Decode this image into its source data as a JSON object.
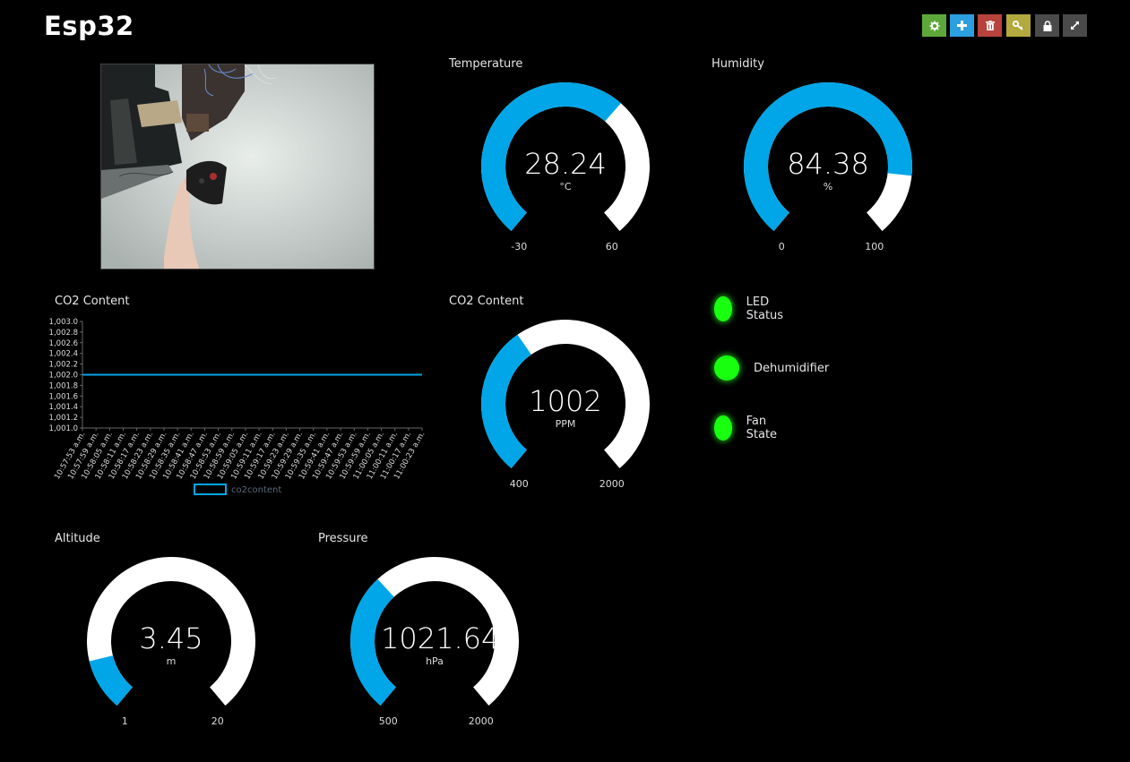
{
  "app": {
    "title": "Esp32"
  },
  "toolbar": {
    "buttons": [
      {
        "icon": "gear-icon",
        "color": "#5ea83b"
      },
      {
        "icon": "plus-icon",
        "color": "#2c9fe0"
      },
      {
        "icon": "trash-icon",
        "color": "#b8423c"
      },
      {
        "icon": "key-icon",
        "color": "#b3a93f"
      },
      {
        "icon": "lock-icon",
        "color": "#4a4a4a"
      },
      {
        "icon": "expand-icon",
        "color": "#4a4a4a"
      }
    ]
  },
  "colors": {
    "accent": "#00a6e7",
    "track": "#ffffff",
    "led_on": "#19ff10"
  },
  "gauges": {
    "temperature": {
      "title": "Temperature",
      "value": "28.24",
      "unit": "°C",
      "min": "-30",
      "max": "60",
      "fraction": 0.647
    },
    "humidity": {
      "title": "Humidity",
      "value": "84.38",
      "unit": "%",
      "min": "0",
      "max": "100",
      "fraction": 0.844
    },
    "co2": {
      "title": "CO2 Content",
      "value": "1002",
      "unit": "PPM",
      "min": "400",
      "max": "2000",
      "fraction": 0.376
    },
    "altitude": {
      "title": "Altitude",
      "value": "3.45",
      "unit": "m",
      "min": "1",
      "max": "20",
      "fraction": 0.129
    },
    "pressure": {
      "title": "Pressure",
      "value": "1021.64",
      "unit": "hPa",
      "min": "500",
      "max": "2000",
      "fraction": 0.348
    }
  },
  "co2_chart_title": "CO2 Content",
  "chart_data": {
    "type": "line",
    "title": "",
    "x": [
      "10:57:53 a.m.",
      "10:57:59 a.m.",
      "10:58:05 a.m.",
      "10:58:11 a.m.",
      "10:58:17 a.m.",
      "10:58:23 a.m.",
      "10:58:29 a.m.",
      "10:58:35 a.m.",
      "10:58:41 a.m.",
      "10:58:47 a.m.",
      "10:58:53 a.m.",
      "10:58:59 a.m.",
      "10:59:05 a.m.",
      "10:59:11 a.m.",
      "10:59:17 a.m.",
      "10:59:23 a.m.",
      "10:59:29 a.m.",
      "10:59:35 a.m.",
      "10:59:41 a.m.",
      "10:59:47 a.m.",
      "10:59:53 a.m.",
      "10:59:59 a.m.",
      "11:00:05 a.m.",
      "11:00:11 a.m.",
      "11:00:17 a.m.",
      "11:00:23 a.m."
    ],
    "series": [
      {
        "name": "co2content",
        "values": [
          1002,
          1002,
          1002,
          1002,
          1002,
          1002,
          1002,
          1002,
          1002,
          1002,
          1002,
          1002,
          1002,
          1002,
          1002,
          1002,
          1002,
          1002,
          1002,
          1002,
          1002,
          1002,
          1002,
          1002,
          1002,
          1002
        ]
      }
    ],
    "yticks": [
      "1,001.0",
      "1,001.2",
      "1,001.4",
      "1,001.6",
      "1,001.8",
      "1,002.0",
      "1,002.2",
      "1,002.4",
      "1,002.6",
      "1,002.8",
      "1,003.0"
    ],
    "ylim": [
      1001.0,
      1003.0
    ],
    "grid": false,
    "legend": "bottom-center"
  },
  "leds": [
    {
      "label": "LED Status"
    },
    {
      "label": "Dehumidifier"
    },
    {
      "label": "Fan State"
    }
  ]
}
